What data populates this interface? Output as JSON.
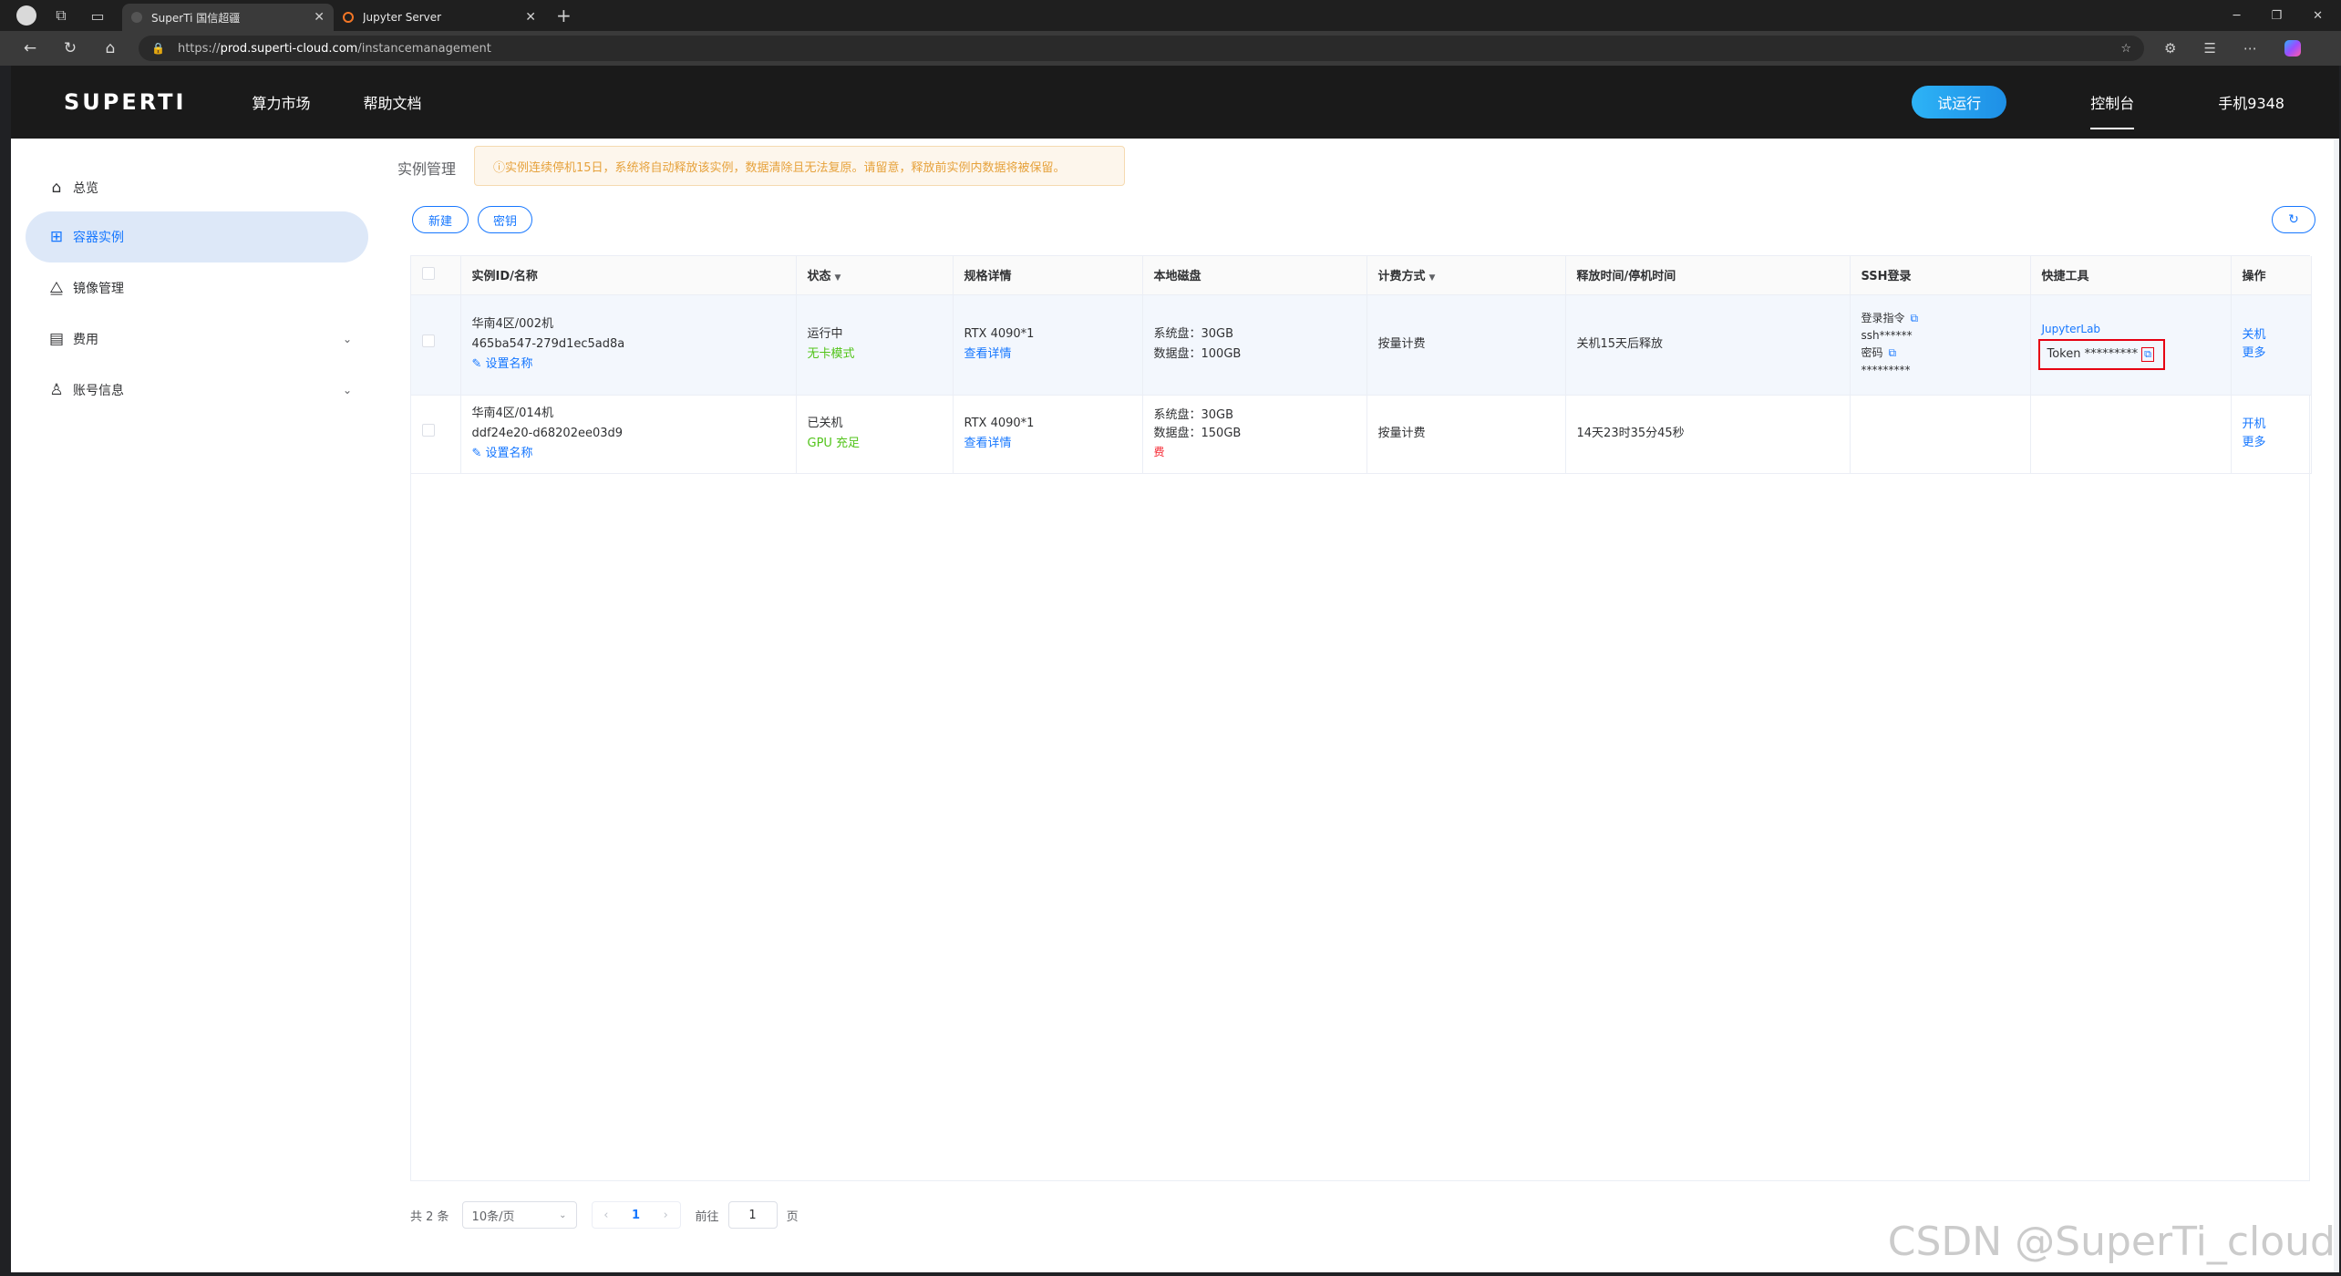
{
  "browser": {
    "tabs": [
      {
        "title": "SuperTi 国信超疆"
      },
      {
        "title": "Jupyter Server"
      }
    ],
    "url_prefix": "https://",
    "url_host": "prod.superti-cloud.com",
    "url_path": "/instancemanagement"
  },
  "header": {
    "logo": "SUPERTI",
    "nav": [
      "算力市场",
      "帮助文档"
    ],
    "trial_button": "试运行",
    "console": "控制台",
    "user": "手机9348"
  },
  "sidebar": {
    "items": [
      {
        "label": "总览",
        "icon": "home-icon"
      },
      {
        "label": "容器实例",
        "icon": "grid-icon"
      },
      {
        "label": "镜像管理",
        "icon": "mirror-icon"
      },
      {
        "label": "费用",
        "icon": "invoice-icon"
      },
      {
        "label": "账号信息",
        "icon": "user-icon"
      }
    ]
  },
  "content": {
    "breadcrumb": "实例管理",
    "notice": "ⓘ实例连续停机15日，系统将自动释放该实例，数据清除且无法复原。请留意，释放前实例内数据将被保留。",
    "new_button": "新建",
    "key_button": "密钥"
  },
  "table": {
    "headers": [
      "实例ID/名称",
      "状态",
      "规格详情",
      "本地磁盘",
      "计费方式",
      "释放时间/停机时间",
      "SSH登录",
      "快捷工具",
      "操作"
    ],
    "rows": [
      {
        "name": "华南4区/002机",
        "id": "465ba547-279d1ec5ad8a",
        "set_name": "设置名称",
        "status": "运行中",
        "mode": "无卡模式",
        "spec": "RTX 4090*1",
        "spec_link": "查看详情",
        "disk_sys": "系统盘：30GB",
        "disk_data": "数据盘：100GB",
        "billing": "按量计费",
        "release": "关机15天后释放",
        "ssh_cmd_label": "登录指令",
        "ssh_cmd": "ssh******",
        "ssh_pwd_label": "密码",
        "ssh_pwd": "*********",
        "tool_link": "JupyterLab",
        "token": "Token *********",
        "op1": "关机",
        "op2": "更多"
      },
      {
        "name": "华南4区/014机",
        "id": "ddf24e20-d68202ee03d9",
        "set_name": "设置名称",
        "status": "已关机",
        "mode": "GPU 充足",
        "spec": "RTX 4090*1",
        "spec_link": "查看详情",
        "disk_sys": "系统盘：30GB",
        "disk_data": "数据盘：150GB",
        "disk_fee": "费",
        "billing": "按量计费",
        "release": "14天23时35分45秒",
        "op1": "开机",
        "op2": "更多"
      }
    ]
  },
  "pagination": {
    "total": "共 2 条",
    "page_size": "10条/页",
    "current": "1",
    "goto_label": "前往",
    "goto_value": "1",
    "page_suffix": "页"
  },
  "watermark": "CSDN @SuperTi_cloud",
  "colors": {
    "accent": "#1677ff",
    "header_bg": "#1a1a1a",
    "notice": "#e6a23c",
    "highlight": "#e60012"
  }
}
